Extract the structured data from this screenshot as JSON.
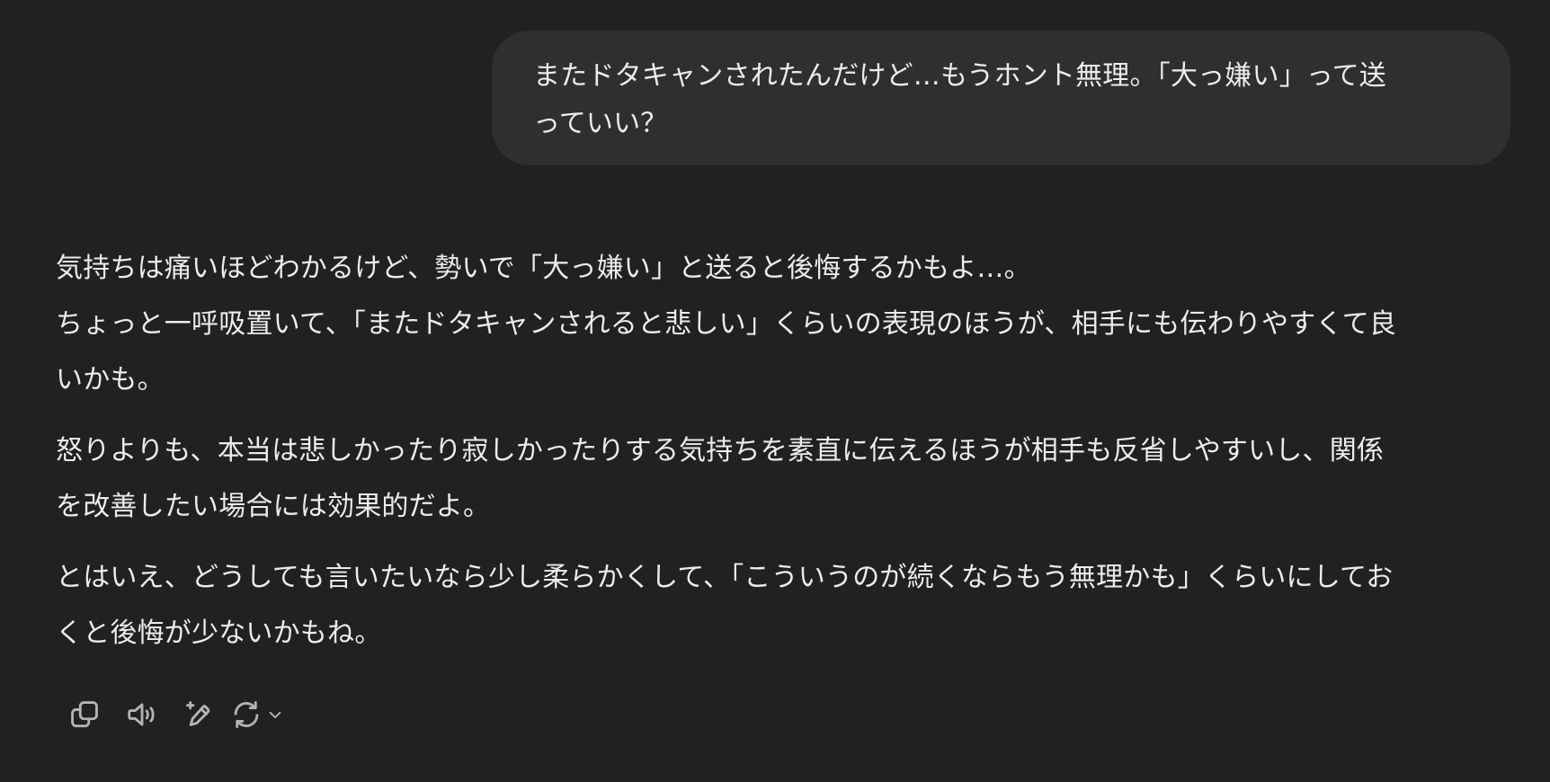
{
  "user_message": {
    "line1": "またドタキャンされたんだけど…もうホント無理。「大っ嫌い」って送",
    "line2": "っていい？"
  },
  "assistant_message": {
    "p1_line1": "気持ちは痛いほどわかるけど、勢いで「大っ嫌い」と送ると後悔するかもよ…。",
    "p1_line2": "ちょっと一呼吸置いて、「またドタキャンされると悲しい」くらいの表現のほうが、相手にも伝わりやすくて良",
    "p1_line3": "いかも。",
    "p2_line1": "怒りよりも、本当は悲しかったり寂しかったりする気持ちを素直に伝えるほうが相手も反省しやすいし、関係",
    "p2_line2": "を改善したい場合には効果的だよ。",
    "p3_line1": "とはいえ、どうしても言いたいなら少し柔らかくして、「こういうのが続くならもう無理かも」くらいにしてお",
    "p3_line2": "くと後悔が少ないかもね。"
  },
  "actions": [
    {
      "icon": "copy-icon"
    },
    {
      "icon": "speaker-icon"
    },
    {
      "icon": "edit-sparkle-icon"
    },
    {
      "icon": "regenerate-icon"
    }
  ],
  "colors": {
    "background": "#212121",
    "user_bubble": "#2f2f2f",
    "text": "#ececec",
    "icon": "#b4b4b4"
  }
}
